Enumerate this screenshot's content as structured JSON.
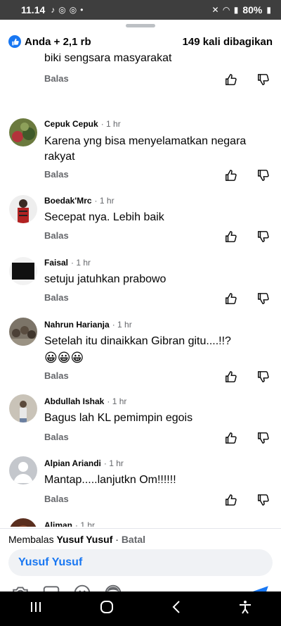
{
  "status_bar": {
    "time": "11.14",
    "battery": "80%"
  },
  "header": {
    "reactions": "Anda + 2,1 rb",
    "shares": "149 kali dibagikan"
  },
  "labels": {
    "reply": "Balas"
  },
  "partial_comment": {
    "text": "biki sengsara masyarakat"
  },
  "comments": [
    {
      "author": "Cepuk Cepuk",
      "time": "1 hr",
      "text": "Karena yng bisa menyelamatkan negara rakyat",
      "avatar_color": "#6b7a3e"
    },
    {
      "author": "Boedak'Mrc",
      "time": "1 hr",
      "text": "Secepat nya. Lebih baik",
      "avatar_color": "#b22222"
    },
    {
      "author": "Faisal",
      "time": "1 hr",
      "text": "setuju jatuhkan prabowo",
      "avatar_color": "#111111"
    },
    {
      "author": "Nahrun Harianja",
      "time": "1 hr",
      "text": "Setelah itu dinaikkan Gibran gitu....!!?",
      "emojis": "😀😀😀",
      "avatar_color": "#7c7468"
    },
    {
      "author": "Abdullah Ishak",
      "time": "1 hr",
      "text": "Bagus lah KL pemimpin egois",
      "avatar_color": "#c9c3b8"
    },
    {
      "author": "Alpian Ariandi",
      "time": "1 hr",
      "text": "Mantap.....lanjutkn Om!!!!!!",
      "avatar_color": "#c4c7cc"
    },
    {
      "author": "Aliman",
      "time": "1 hr",
      "avatar_color": "#5a2e1e"
    }
  ],
  "reply_bar": {
    "prefix": "Membalas",
    "target": "Yusuf Yusuf",
    "separator": "·",
    "cancel": "Batal"
  },
  "input": {
    "value": "Yusuf Yusuf"
  },
  "toolbar": {
    "icons": [
      "camera-icon",
      "gif-icon",
      "emoji-icon",
      "avatar-sticker-icon",
      "send-icon"
    ]
  },
  "nav": {
    "icons": [
      "recent-apps-icon",
      "home-icon",
      "back-icon",
      "accessibility-icon"
    ]
  }
}
